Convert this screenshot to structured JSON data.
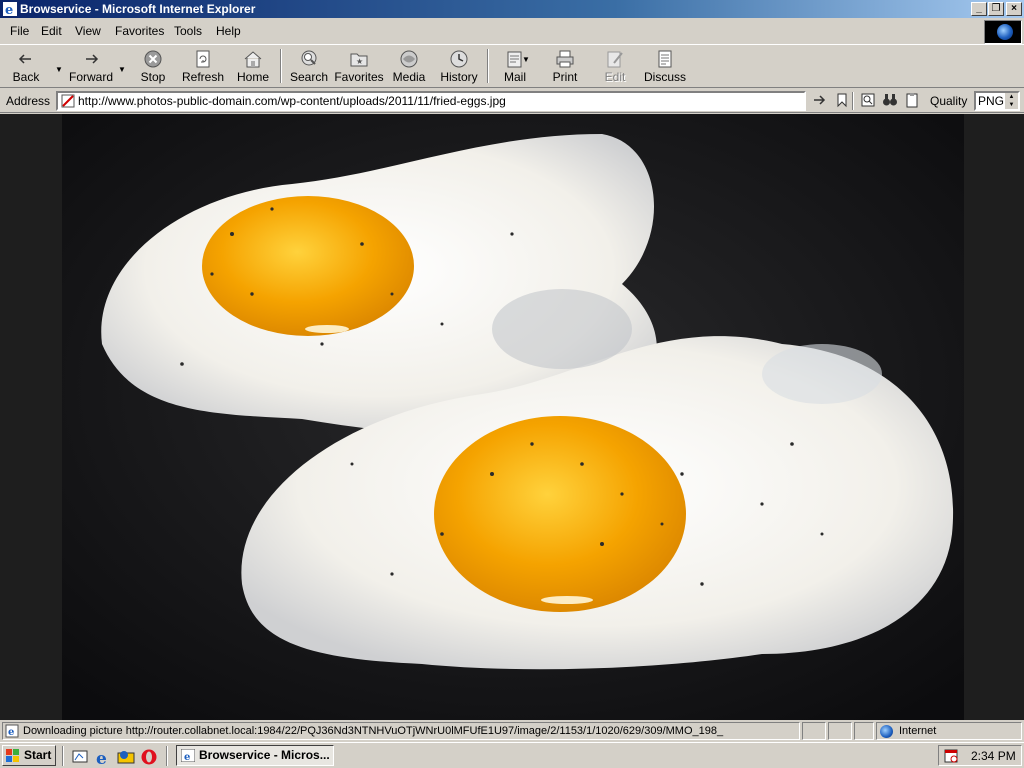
{
  "window": {
    "title": "Browservice - Microsoft Internet Explorer",
    "controls": [
      "minimize-icon",
      "restore-icon",
      "close-icon"
    ]
  },
  "menu": {
    "file": "File",
    "edit": "Edit",
    "view": "View",
    "favorites": "Favorites",
    "tools": "Tools",
    "help": "Help"
  },
  "toolbar": {
    "back": "Back",
    "forward": "Forward",
    "stop": "Stop",
    "refresh": "Refresh",
    "home": "Home",
    "search": "Search",
    "favorites": "Favorites",
    "media": "Media",
    "history": "History",
    "mail": "Mail",
    "print": "Print",
    "edit": "Edit",
    "discuss": "Discuss"
  },
  "address": {
    "label": "Address",
    "url": "http://www.photos-public-domain.com/wp-content/uploads/2011/11/fried-eggs.jpg",
    "quality_label": "Quality",
    "quality_value": "PNG"
  },
  "content": {
    "image_alt": "fried eggs",
    "colors": {
      "background": "#1e1e1e",
      "yolk": "#f5a300",
      "white": "#f2f0ea"
    }
  },
  "status": {
    "text": "Downloading picture http://router.collabnet.local:1984/22/PQJ36Nd3NTNHVuOTjWNrU0lMFUfE1U97/image/2/1153/1/1020/629/309/MMO_198_",
    "zone": "Internet"
  },
  "taskbar": {
    "start": "Start",
    "task": "Browservice - Micros...",
    "clock": "2:34 PM"
  },
  "colors": {
    "titlebar_start": "#0a246a",
    "titlebar_end": "#a6caf0",
    "chrome": "#d4d0c8"
  }
}
